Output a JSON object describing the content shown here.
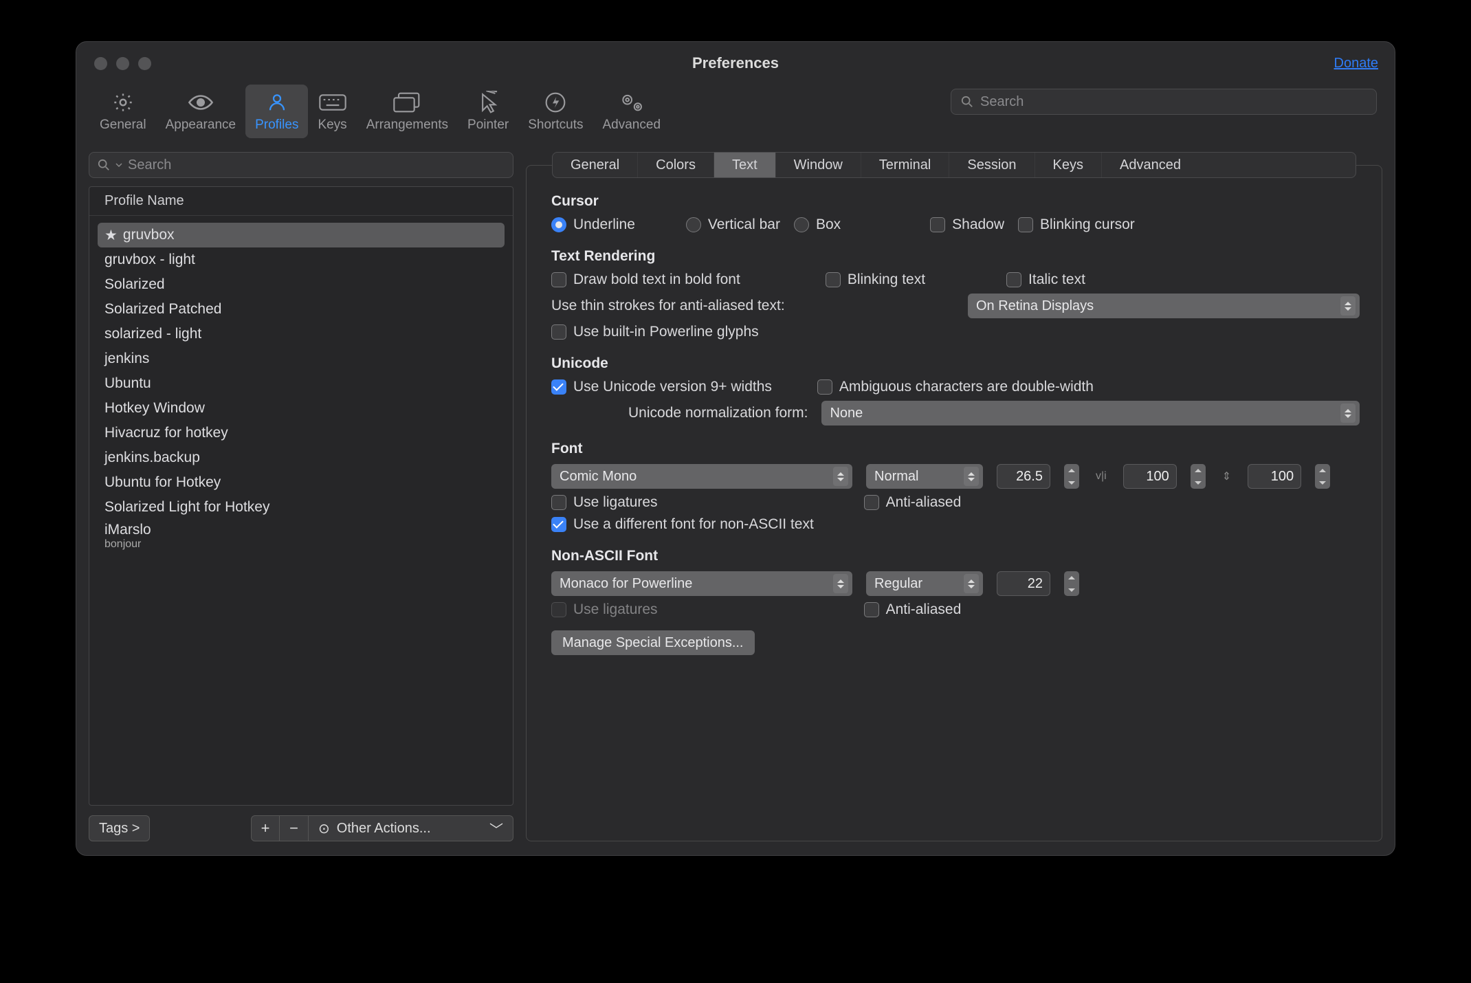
{
  "window": {
    "title": "Preferences",
    "donate": "Donate"
  },
  "toolbar": {
    "items": [
      {
        "key": "general",
        "label": "General"
      },
      {
        "key": "appearance",
        "label": "Appearance"
      },
      {
        "key": "profiles",
        "label": "Profiles"
      },
      {
        "key": "keys",
        "label": "Keys"
      },
      {
        "key": "arrangements",
        "label": "Arrangements"
      },
      {
        "key": "pointer",
        "label": "Pointer"
      },
      {
        "key": "shortcuts",
        "label": "Shortcuts"
      },
      {
        "key": "advanced",
        "label": "Advanced"
      }
    ],
    "active": "profiles",
    "search_placeholder": "Search"
  },
  "profiles": {
    "search_placeholder": "Search",
    "header": "Profile Name",
    "tags_button": "Tags >",
    "other_actions": "Other Actions...",
    "items": [
      {
        "name": "gruvbox",
        "star": true,
        "selected": true
      },
      {
        "name": "gruvbox - light"
      },
      {
        "name": "Solarized"
      },
      {
        "name": "Solarized Patched"
      },
      {
        "name": "solarized - light"
      },
      {
        "name": "jenkins"
      },
      {
        "name": "Ubuntu"
      },
      {
        "name": "Hotkey Window"
      },
      {
        "name": "Hivacruz for hotkey",
        "dot": true
      },
      {
        "name": "jenkins.backup"
      },
      {
        "name": "Ubuntu for Hotkey"
      },
      {
        "name": "Solarized Light for Hotkey"
      },
      {
        "name": "iMarslo",
        "subtitle": "bonjour"
      }
    ]
  },
  "right_tabs": {
    "items": [
      "General",
      "Colors",
      "Text",
      "Window",
      "Terminal",
      "Session",
      "Keys",
      "Advanced"
    ],
    "active": "Text"
  },
  "text_panel": {
    "cursor": {
      "title": "Cursor",
      "underline": "Underline",
      "vertical": "Vertical bar",
      "box": "Box",
      "shadow": "Shadow",
      "blinking": "Blinking cursor",
      "selected": "underline"
    },
    "text_rendering": {
      "title": "Text Rendering",
      "bold": "Draw bold text in bold font",
      "blinking": "Blinking text",
      "italic": "Italic text",
      "thin_label": "Use thin strokes for anti-aliased text:",
      "thin_value": "On Retina Displays",
      "powerline": "Use built-in Powerline glyphs"
    },
    "unicode": {
      "title": "Unicode",
      "v9": "Use Unicode version 9+ widths",
      "ambiguous": "Ambiguous characters are double-width",
      "norm_label": "Unicode normalization form:",
      "norm_value": "None"
    },
    "font": {
      "title": "Font",
      "family": "Comic Mono",
      "weight": "Normal",
      "size": "26.5",
      "letter": "100",
      "line": "100",
      "ligatures": "Use ligatures",
      "aa": "Anti-aliased",
      "diff": "Use a different font for non-ASCII text"
    },
    "nonascii": {
      "title": "Non-ASCII Font",
      "family": "Monaco for Powerline",
      "weight": "Regular",
      "size": "22",
      "ligatures": "Use ligatures",
      "aa": "Anti-aliased"
    },
    "manage": "Manage Special Exceptions..."
  }
}
